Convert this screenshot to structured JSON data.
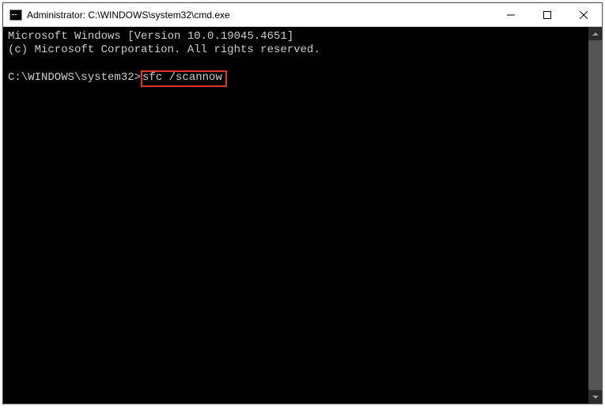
{
  "window": {
    "title": "Administrator: C:\\WINDOWS\\system32\\cmd.exe"
  },
  "terminal": {
    "line1": "Microsoft Windows [Version 10.0.19045.4651]",
    "line2": "(c) Microsoft Corporation. All rights reserved.",
    "blank": "",
    "prompt": "C:\\WINDOWS\\system32>",
    "command": "sfc /scannow"
  }
}
